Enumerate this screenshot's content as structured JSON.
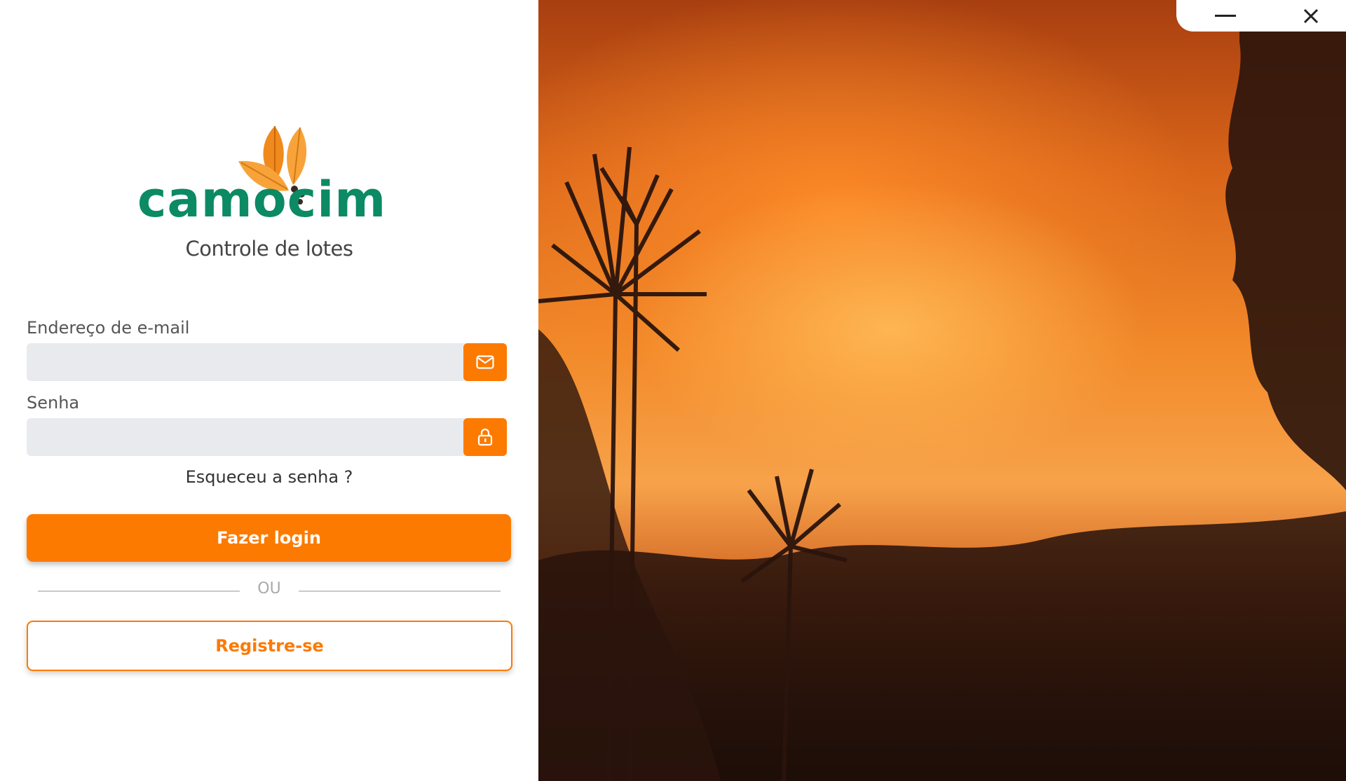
{
  "window": {
    "minimize_icon": "minimize-icon",
    "close_icon": "close-icon"
  },
  "brand": {
    "name": "camocim",
    "subtitle": "Controle de lotes",
    "logo_icon": "coffee-leaves-logo",
    "color": "#0b8a63"
  },
  "form": {
    "email": {
      "label": "Endereço de e-mail",
      "value": "",
      "placeholder": "",
      "icon": "mail-icon"
    },
    "password": {
      "label": "Senha",
      "value": "",
      "placeholder": "",
      "icon": "lock-icon"
    },
    "forgot_label": "Esqueceu a senha ?",
    "login_label": "Fazer login",
    "divider_label": "OU",
    "register_label": "Registre-se"
  },
  "colors": {
    "accent": "#fd7a00",
    "field_bg": "#e9eaee"
  }
}
